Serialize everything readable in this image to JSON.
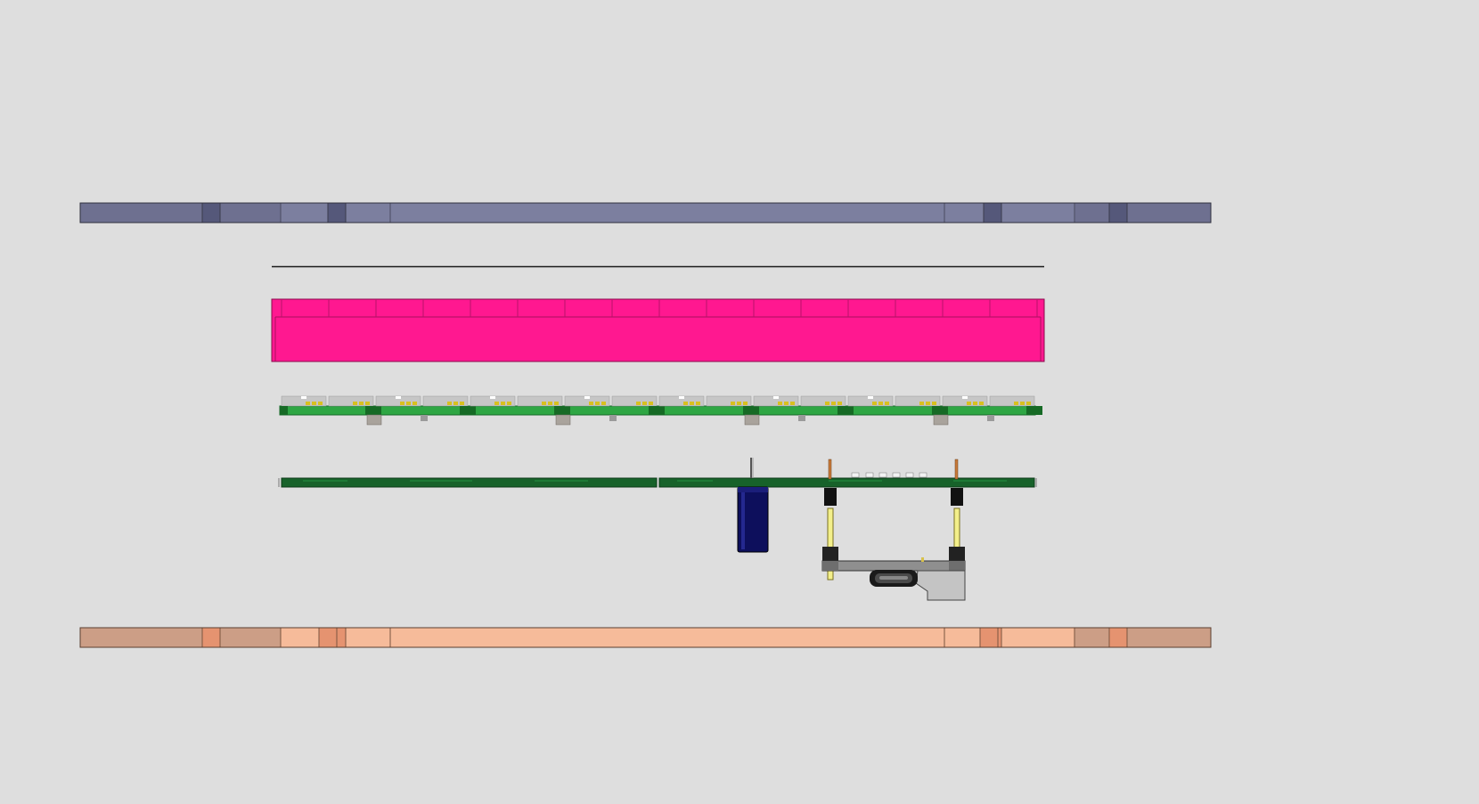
{
  "view": {
    "background": "#dedede",
    "layers": [
      {
        "id": "top-plate",
        "color": "#7a7c9e"
      },
      {
        "id": "separator-line",
        "color": "#1a1a1a"
      },
      {
        "id": "diffuser",
        "color": "#ff1890"
      },
      {
        "id": "led-strip",
        "color": "#2ea643"
      },
      {
        "id": "controller-board",
        "color": "#17622a"
      },
      {
        "id": "capacitor",
        "color": "#0d0f5c"
      },
      {
        "id": "micro-usb-connector",
        "color": "#c4c4c4"
      },
      {
        "id": "bottom-plate",
        "color": "#f6bb9a"
      }
    ]
  }
}
